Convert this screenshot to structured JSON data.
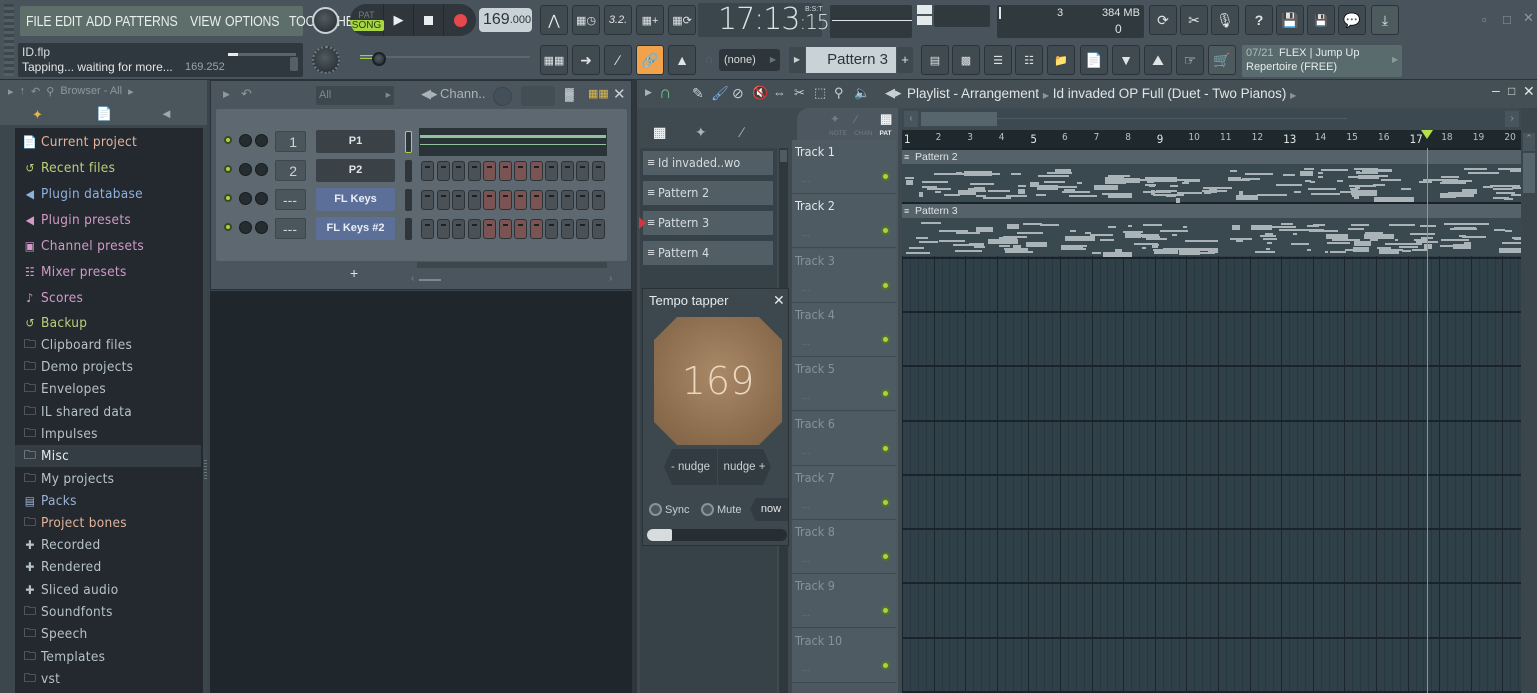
{
  "menu": [
    "FILE",
    "EDIT",
    "ADD",
    "PATTERNS",
    "VIEW",
    "OPTIONS",
    "TOOLS",
    "HELP"
  ],
  "hint": {
    "file": "ID.flp",
    "text": "Tapping... waiting for more...",
    "value": "169.252"
  },
  "transport": {
    "pat_label": "PAT",
    "song_label": "SONG",
    "mode": "SONG",
    "tempo_int": "169",
    "tempo_dec": ".000"
  },
  "clock": {
    "main": "17:13",
    "sub": ":15",
    "unit": "B:S:T"
  },
  "cpu": {
    "polyphony": "3",
    "memory": "384 MB",
    "voices": "0"
  },
  "master_pitch_value": 0.12,
  "snap": {
    "value": "(none)"
  },
  "pattern_selector": {
    "value": "Pattern 3",
    "add": "+"
  },
  "news": {
    "counter": "07/21",
    "title": "FLEX | Jump Up",
    "subtitle": "Repertoire (FREE)"
  },
  "colors": {
    "accent_green": "#a6d641",
    "link_orange": "#f2a24a",
    "tap_pad": "#9a7a58"
  },
  "browser": {
    "title": "Browser - All",
    "items": [
      {
        "label": "Current project",
        "icon": "document-icon",
        "color": "#e3b49b"
      },
      {
        "label": "Recent files",
        "icon": "recent-folder-icon",
        "color": "#b9d27a"
      },
      {
        "label": "Plugin database",
        "icon": "plug-icon",
        "color": "#8fb1dd"
      },
      {
        "label": "Plugin presets",
        "icon": "plug-icon",
        "color": "#d39ac8"
      },
      {
        "label": "Channel presets",
        "icon": "channel-icon",
        "color": "#d39ac8"
      },
      {
        "label": "Mixer presets",
        "icon": "mixer-icon",
        "color": "#d39ac8"
      },
      {
        "label": "Scores",
        "icon": "note-icon",
        "color": "#d39ac8"
      },
      {
        "label": "Backup",
        "icon": "recent-folder-icon",
        "color": "#b9d27a"
      },
      {
        "label": "Clipboard files",
        "icon": "folder-icon",
        "color": "#b6c3c9"
      },
      {
        "label": "Demo projects",
        "icon": "folder-icon",
        "color": "#b6c3c9"
      },
      {
        "label": "Envelopes",
        "icon": "folder-icon",
        "color": "#b6c3c9"
      },
      {
        "label": "IL shared data",
        "icon": "folder-icon",
        "color": "#b6c3c9"
      },
      {
        "label": "Impulses",
        "icon": "folder-icon",
        "color": "#b6c3c9"
      },
      {
        "label": "Misc",
        "icon": "folder-icon",
        "color": "#e6eaec",
        "selected": true
      },
      {
        "label": "My projects",
        "icon": "folder-icon",
        "color": "#b6c3c9"
      },
      {
        "label": "Packs",
        "icon": "packs-icon",
        "color": "#9cb2d4"
      },
      {
        "label": "Project bones",
        "icon": "folder-icon",
        "color": "#e3b49b"
      },
      {
        "label": "Recorded",
        "icon": "wave-icon",
        "color": "#b6c3c9"
      },
      {
        "label": "Rendered",
        "icon": "wave-icon",
        "color": "#b6c3c9"
      },
      {
        "label": "Sliced audio",
        "icon": "wave-icon",
        "color": "#b6c3c9"
      },
      {
        "label": "Soundfonts",
        "icon": "folder-icon",
        "color": "#b6c3c9"
      },
      {
        "label": "Speech",
        "icon": "folder-icon",
        "color": "#b6c3c9"
      },
      {
        "label": "Templates",
        "icon": "folder-icon",
        "color": "#b6c3c9"
      },
      {
        "label": "vst",
        "icon": "folder-icon",
        "color": "#b6c3c9"
      }
    ]
  },
  "channel_rack": {
    "filter": "All",
    "title": "Chann..",
    "add": "+",
    "channels": [
      {
        "number": "1",
        "name": "P1",
        "style": "dark",
        "type": "piano-roll"
      },
      {
        "number": "2",
        "name": "P2",
        "style": "dark",
        "type": "steps"
      },
      {
        "number": "---",
        "name": "FL Keys",
        "style": "blue",
        "type": "steps"
      },
      {
        "number": "---",
        "name": "FL Keys #2",
        "style": "blue",
        "type": "steps"
      }
    ],
    "step_pattern": [
      0,
      0,
      0,
      0,
      1,
      1,
      1,
      1,
      0,
      0,
      0,
      0
    ]
  },
  "playlist": {
    "title": "Playlist - Arrangement",
    "song": "Id invaded OP Full (Duet - Two Pianos)",
    "filter_labels": [
      "NOTE",
      "CHAN",
      "PAT"
    ],
    "patterns": [
      "Id invaded..wo Pianos)",
      "Pattern 2",
      "Pattern 3",
      "Pattern 4"
    ],
    "current_pattern_index": 2,
    "ruler": [
      "1",
      "2",
      "3",
      "4",
      "5",
      "6",
      "7",
      "8",
      "9",
      "10",
      "11",
      "12",
      "13",
      "14",
      "15",
      "16",
      "17",
      "18",
      "19",
      "20"
    ],
    "playhead_bar": 17.6,
    "tracks": [
      "Track 1",
      "Track 2",
      "Track 3",
      "Track 4",
      "Track 5",
      "Track 6",
      "Track 7",
      "Track 8",
      "Track 9",
      "Track 10"
    ],
    "clips": [
      {
        "track": 0,
        "label": "Pattern 2"
      },
      {
        "track": 1,
        "label": "Pattern 3"
      }
    ],
    "track_more": "..."
  },
  "tapper": {
    "title": "Tempo tapper",
    "bpm": "169",
    "nudge_minus": "- nudge",
    "nudge_plus": "nudge +",
    "sync": "Sync",
    "mute": "Mute",
    "now": "now",
    "progress": 0.18
  }
}
